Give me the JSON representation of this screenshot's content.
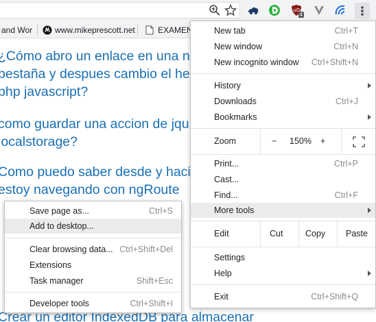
{
  "bookmarks": {
    "item1": "and Wor",
    "item2": "www.mikeprescott.net",
    "item3": "EXAMEN"
  },
  "page": {
    "q1_line1": "¿Cómo abro un enlace en una n",
    "q1_line2": "pestaña y despues cambio el he",
    "q1_line3": "php javascript?",
    "q2_line1": "como guardar una accion de jqu",
    "q2_line2": "localstorage?",
    "q3_line1": "Como puedo saber desde y haci",
    "q3_line2": "estoy navegando con ngRoute",
    "q4_line1": "Crear un editor IndexedDB para almacenar"
  },
  "extensions": {
    "badge": "4"
  },
  "menu": {
    "new_tab": "New tab",
    "new_tab_sc": "Ctrl+T",
    "new_window": "New window",
    "new_window_sc": "Ctrl+N",
    "new_incognito": "New incognito window",
    "new_incognito_sc": "Ctrl+Shift+N",
    "history": "History",
    "downloads": "Downloads",
    "downloads_sc": "Ctrl+J",
    "bookmarks": "Bookmarks",
    "zoom": "Zoom",
    "zoom_minus": "−",
    "zoom_value": "150%",
    "zoom_plus": "+",
    "print": "Print...",
    "print_sc": "Ctrl+P",
    "cast": "Cast...",
    "find": "Find...",
    "find_sc": "Ctrl+F",
    "more_tools": "More tools",
    "edit": "Edit",
    "cut": "Cut",
    "copy": "Copy",
    "paste": "Paste",
    "settings": "Settings",
    "help": "Help",
    "exit": "Exit",
    "exit_sc": "Ctrl+Shift+Q"
  },
  "submenu": {
    "save_page": "Save page as...",
    "save_page_sc": "Ctrl+S",
    "add_desktop": "Add to desktop...",
    "clear_data": "Clear browsing data...",
    "clear_data_sc": "Ctrl+Shift+Del",
    "extensions": "Extensions",
    "task_manager": "Task manager",
    "task_manager_sc": "Shift+Esc",
    "dev_tools": "Developer tools",
    "dev_tools_sc": "Ctrl+Shift+I"
  },
  "colors": {
    "link": "#1a6fb3",
    "highlight": "#ebebeb",
    "toolbar": "#f1f3f4"
  }
}
